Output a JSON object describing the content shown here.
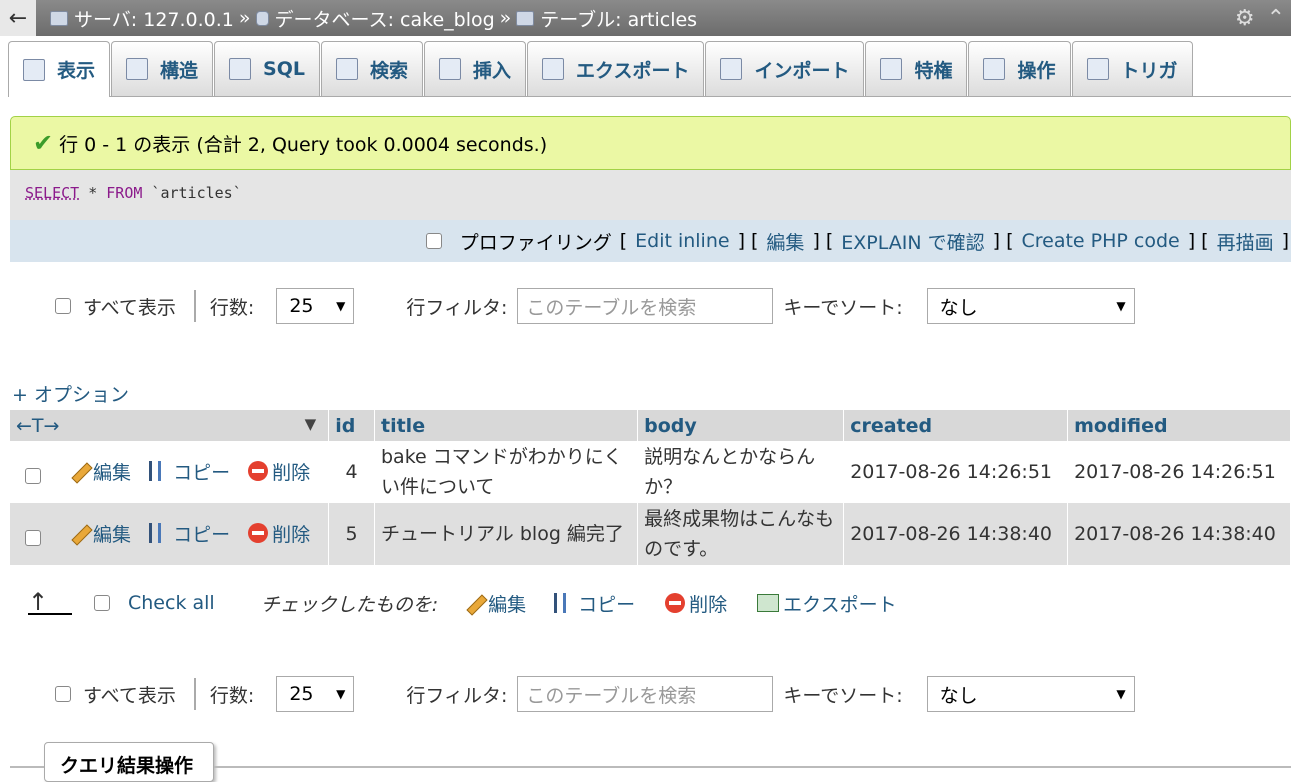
{
  "breadcrumb": {
    "back": "←",
    "server": "サーバ: 127.0.0.1",
    "sep": "»",
    "database": "データベース: cake_blog",
    "table": "テーブル: articles",
    "gear": "⚙",
    "collapse": "⌃"
  },
  "tabs": [
    {
      "label": "表示",
      "icon": "browse-icon"
    },
    {
      "label": "構造",
      "icon": "structure-icon"
    },
    {
      "label": "SQL",
      "icon": "sql-icon"
    },
    {
      "label": "検索",
      "icon": "search-icon"
    },
    {
      "label": "挿入",
      "icon": "insert-icon"
    },
    {
      "label": "エクスポート",
      "icon": "export-icon"
    },
    {
      "label": "インポート",
      "icon": "import-icon"
    },
    {
      "label": "特権",
      "icon": "privileges-icon"
    },
    {
      "label": "操作",
      "icon": "operations-icon"
    },
    {
      "label": "トリガ",
      "icon": "triggers-icon"
    }
  ],
  "message": {
    "icon": "✔",
    "text": "行 0 - 1 の表示 (合計 2, Query took 0.0004 seconds.)"
  },
  "sql": {
    "select": "SELECT",
    "star": " * ",
    "from": "FROM",
    "table": " `articles`"
  },
  "profiling": {
    "label": "プロファイリング",
    "lb": "[",
    "rb": "]",
    "edit_inline": "Edit inline",
    "edit": "編集",
    "explain": "EXPLAIN で確認",
    "create_php": "Create PHP code",
    "refresh": "再描画"
  },
  "nav": {
    "show_all": "すべて表示",
    "rows_label": "行数:",
    "rows_value": "25",
    "filter_label": "行フィルタ:",
    "filter_placeholder": "このテーブルを検索",
    "sort_label": "キーでソート:",
    "sort_value": "なし"
  },
  "options_link": "+ オプション",
  "table": {
    "arrows": "←T→",
    "sort_arrow": "▼",
    "columns": [
      "id",
      "title",
      "body",
      "created",
      "modified"
    ],
    "actions": {
      "edit": "編集",
      "copy": "コピー",
      "delete": "削除"
    },
    "rows": [
      {
        "id": "4",
        "title": "bake コマンドがわかりにくい件について",
        "body": "説明なんとかならんか？",
        "created": "2017-08-26 14:26:51",
        "modified": "2017-08-26 14:26:51"
      },
      {
        "id": "5",
        "title": "チュートリアル blog 編完了",
        "body": "最終成果物はこんなものです。",
        "created": "2017-08-26 14:38:40",
        "modified": "2017-08-26 14:38:40"
      }
    ]
  },
  "bulk": {
    "arrow": "↑",
    "check_all": "Check all",
    "with_selected": "チェックしたものを:",
    "edit": "編集",
    "copy": "コピー",
    "delete": "削除",
    "export": "エクスポート"
  },
  "query_ops": "クエリ結果操作"
}
